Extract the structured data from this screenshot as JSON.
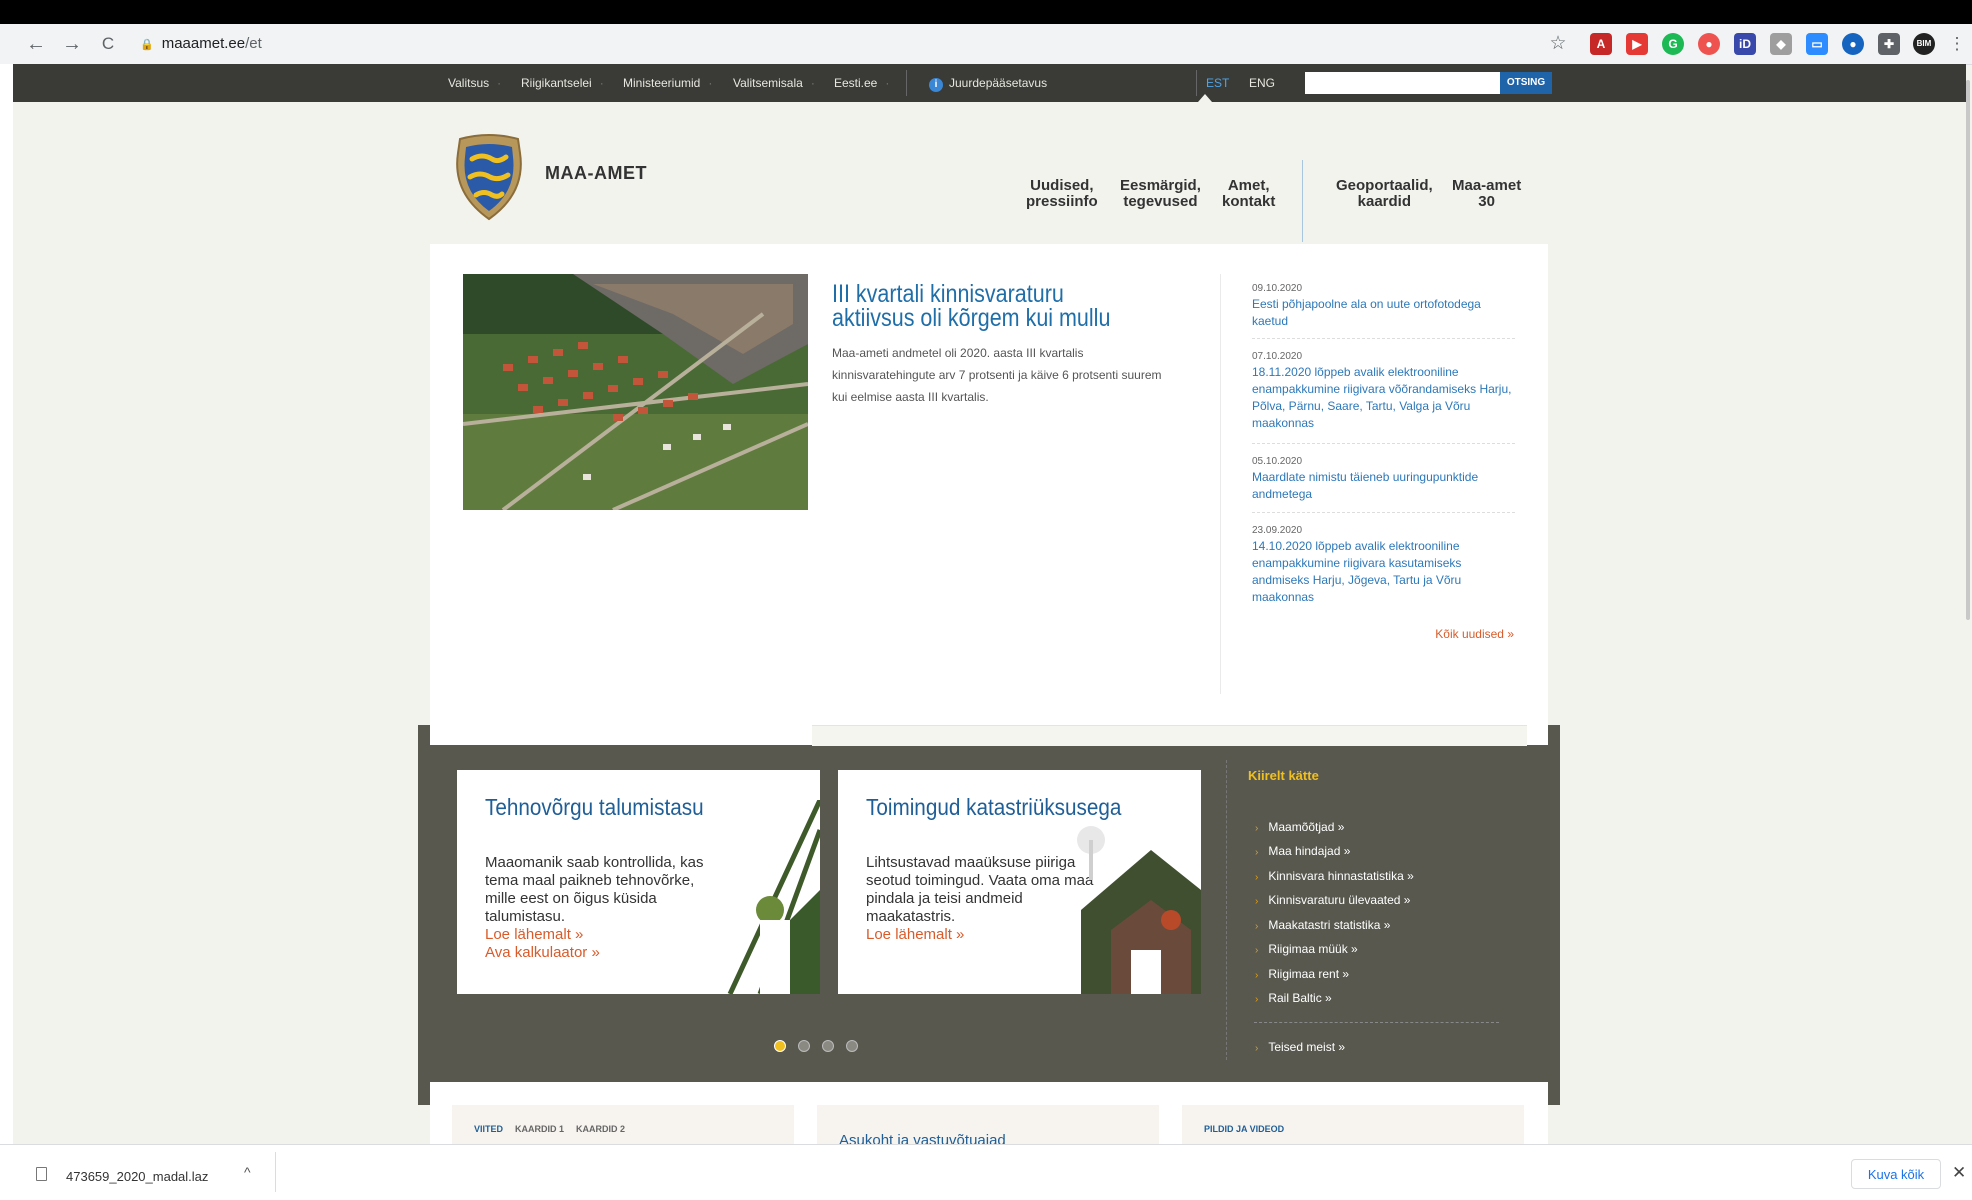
{
  "browser": {
    "url_host": "maaamet.ee",
    "url_path": "/et",
    "nav_back": "←",
    "nav_forward": "→",
    "nav_reload": "C",
    "star": "☆",
    "menu": "⋮"
  },
  "gov_bar": {
    "links": [
      "Valitsus",
      "Riigikantselei",
      "Ministeeriumid",
      "Valitsemisala",
      "Eesti.ee"
    ],
    "accessibility": "Juurdepääsetavus",
    "lang_est": "EST",
    "lang_eng": "ENG",
    "search_placeholder": "",
    "search_button": "OTSING"
  },
  "header": {
    "site_name": "MAA-AMET",
    "nav": [
      {
        "line1": "Uudised,",
        "line2": "pressiinfo"
      },
      {
        "line1": "Eesmärgid,",
        "line2": "tegevused"
      },
      {
        "line1": "Amet,",
        "line2": "kontakt"
      },
      {
        "line1": "Geoportaalid,",
        "line2": "kaardid"
      },
      {
        "line1": "Maa-amet",
        "line2": "30"
      }
    ]
  },
  "hero": {
    "title": "III kvartali kinnisvaraturu aktiivsus oli kõrgem kui mullu",
    "text": "Maa-ameti andmetel oli 2020. aasta III kvartalis kinnisvaratehingute arv 7 protsenti ja käive 6 protsenti suurem kui eelmise aasta III kvartalis."
  },
  "news": [
    {
      "date": "09.10.2020",
      "text": "Eesti põhjapoolne ala on uute ortofotodega kaetud"
    },
    {
      "date": "07.10.2020",
      "text": "18.11.2020 lõppeb avalik elektrooniline enampakkumine riigivara võõrandamiseks Harju, Põlva, Pärnu, Saare, Tartu, Valga ja Võru maakonnas"
    },
    {
      "date": "05.10.2020",
      "text": "Maardlate nimistu täieneb uuringupunktide andmetega"
    },
    {
      "date": "23.09.2020",
      "text": "14.10.2020 lõppeb avalik elektrooniline enampakkumine riigivara kasutamiseks andmiseks Harju, Jõgeva, Tartu ja Võru maakonnas"
    }
  ],
  "all_news": "Kõik uudised »",
  "cards": [
    {
      "title": "Tehnovõrgu talumistasu",
      "text": "Maaomanik saab kontrollida, kas tema maal paikneb tehnovõrke, mille eest on õigus küsida talumistasu.",
      "link1": "Loe lähemalt »",
      "link2": "Ava kalkulaator »"
    },
    {
      "title": "Toimingud katastriüksusega",
      "text": "Lihtsustavad maaüksuse piiriga seotud toimingud. Vaata oma maa pindala ja teisi andmeid maakatastris.",
      "link1": "Loe lähemalt »"
    }
  ],
  "quick": {
    "heading": "Kiirelt kätte",
    "items": [
      "Maamõõtjad »",
      "Maa hindajad »",
      "Kinnisvara hinnastatistika »",
      "Kinnisvaraturu ülevaated »",
      "Maakatastri statistika »",
      "Riigimaa müük »",
      "Riigimaa rent »",
      "Rail Baltic »"
    ],
    "other": "Teised meist »"
  },
  "carousel": {
    "active": 1,
    "total": 4
  },
  "bottom": {
    "tabs1": [
      "VIITED",
      "KAARDID 1",
      "KAARDID 2"
    ],
    "card2_title": "Asukoht ja vastuvõtuajad",
    "tabs3": [
      "PILDID JA VIDEOD"
    ]
  },
  "download": {
    "file": "473659_2020_madal.laz",
    "show_all": "Kuva kõik",
    "close": "✕",
    "caret": "^"
  },
  "colors": {
    "accent": "#1f6ea8",
    "link_orange": "#d95b2a",
    "gov_bar": "#3a3a36",
    "band": "#58584f",
    "quick_head": "#f0c020"
  }
}
